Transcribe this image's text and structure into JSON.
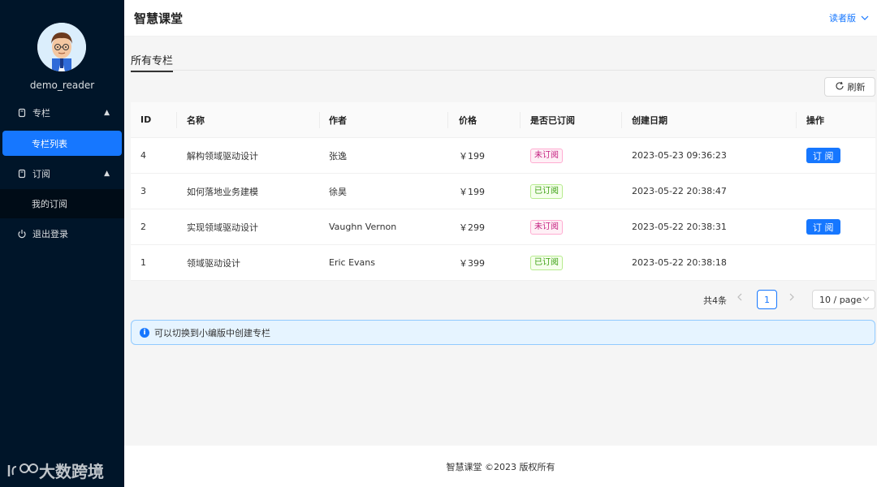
{
  "sidebar": {
    "username": "demo_reader",
    "menu": {
      "columns_group": "专栏",
      "columns_list": "专栏列表",
      "subscribe_group": "订阅",
      "my_subscriptions": "我的订阅",
      "logout": "退出登录"
    },
    "logo_text": "大数跨境"
  },
  "header": {
    "title": "智慧课堂",
    "role": "读者版"
  },
  "main": {
    "tab": "所有专栏",
    "refresh_label": "刷新",
    "table": {
      "columns": [
        "ID",
        "名称",
        "作者",
        "价格",
        "是否已订阅",
        "创建日期",
        "操作"
      ],
      "rows": [
        {
          "id": "4",
          "name": "解构领域驱动设计",
          "author": "张逸",
          "price": "￥199",
          "status": "未订阅",
          "subscribed": false,
          "date": "2023-05-23 09:36:23",
          "action": "订 阅"
        },
        {
          "id": "3",
          "name": "如何落地业务建模",
          "author": "徐昊",
          "price": "￥199",
          "status": "已订阅",
          "subscribed": true,
          "date": "2023-05-22 20:38:47",
          "action": ""
        },
        {
          "id": "2",
          "name": "实现领域驱动设计",
          "author": "Vaughn Vernon",
          "price": "￥299",
          "status": "未订阅",
          "subscribed": false,
          "date": "2023-05-22 20:38:31",
          "action": "订 阅"
        },
        {
          "id": "1",
          "name": "领域驱动设计",
          "author": "Eric Evans",
          "price": "￥399",
          "status": "已订阅",
          "subscribed": true,
          "date": "2023-05-22 20:38:18",
          "action": ""
        }
      ]
    },
    "pagination": {
      "total": "共4条",
      "current_page": "1",
      "page_size": "10 / page"
    },
    "alert": "可以切换到小编版中创建专栏"
  },
  "footer": "智慧课堂 ©2023 版权所有",
  "colors": {
    "sidebar_bg": "#001529",
    "primary": "#1677ff"
  }
}
